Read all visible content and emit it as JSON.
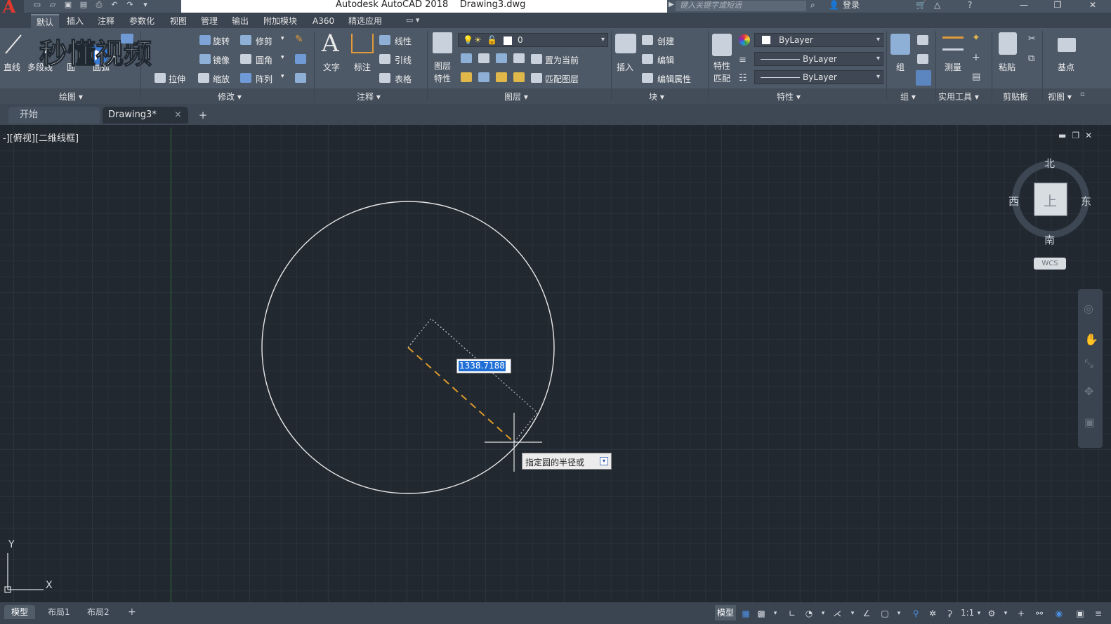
{
  "titlebar": {
    "title": "Autodesk AutoCAD 2018    Drawing3.dwg",
    "search_placeholder": "键入关键字或短语",
    "login": "登录",
    "minimize": "—",
    "restore": "❐",
    "close": "✕"
  },
  "menu": {
    "tabs": [
      "默认",
      "插入",
      "注释",
      "参数化",
      "视图",
      "管理",
      "输出",
      "附加模块",
      "A360",
      "精选应用"
    ]
  },
  "ribbon": {
    "draw": {
      "line": "直线",
      "polyline": "多段线",
      "circle": "圆",
      "arc": "圆弧"
    },
    "modify": {
      "rotate": "旋转",
      "trim": "修剪",
      "mirror": "镜像",
      "fillet": "圆角",
      "stretch": "拉伸",
      "scale": "缩放",
      "array": "阵列"
    },
    "annotation": {
      "text": "文字",
      "dimension": "标注",
      "linear": "线性",
      "leader": "引线",
      "table": "表格"
    },
    "layers": {
      "layer_props": "图层\n特性",
      "layer_value": "0",
      "set_current": "置为当前",
      "match_layer": "匹配图层"
    },
    "block": {
      "insert": "插入",
      "create": "创建",
      "edit": "编辑",
      "edit_attr": "编辑属性"
    },
    "properties": {
      "match": "特性\n匹配",
      "color": "ByLayer",
      "linetype": "ByLayer",
      "lineweight": "ByLayer"
    },
    "groups": {
      "group": "组"
    },
    "utilities": {
      "measure": "测量"
    },
    "clipboard": {
      "paste": "粘贴"
    },
    "view": {
      "base": "基点"
    },
    "panel_titles": [
      "绘图 ▾",
      "修改 ▾",
      "注释 ▾",
      "图层 ▾",
      "块 ▾",
      "特性 ▾",
      "组 ▾",
      "实用工具 ▾",
      "剪贴板",
      "视图 ▾"
    ]
  },
  "watermark": {
    "text": "秒懂视频"
  },
  "doctabs": {
    "start": "开始",
    "drawing": "Drawing3*",
    "close": "×",
    "add": "+"
  },
  "viewport": {
    "label": "-][俯视][二维线框]"
  },
  "viewcube": {
    "north": "北",
    "south": "南",
    "east": "东",
    "west": "西",
    "top": "上",
    "wcs": "WCS"
  },
  "drawing": {
    "dynamic_input_value": "1338.7188",
    "prompt": "指定圆的半径或",
    "prompt_arrow": "▾",
    "ucs_x": "X",
    "ucs_y": "Y"
  },
  "status": {
    "layout_tabs": [
      "模型",
      "布局1",
      "布局2"
    ],
    "add": "+",
    "model_label": "模型",
    "scale": "1:1"
  },
  "colors": {
    "background": "#212830",
    "ribbon": "#4e5967",
    "accent": "#1f6fd6",
    "dashed_line": "#d99a2b"
  }
}
